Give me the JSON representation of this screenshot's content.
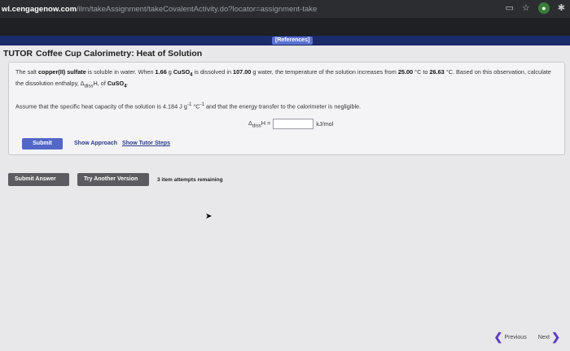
{
  "browser": {
    "url_host": "wl.cengagenow.com",
    "url_path": "/ilrn/takeAssignment/takeCovalentActivity.do?locator=assignment-take"
  },
  "references_label": "[References]",
  "title": {
    "prefix": "TUTOR",
    "text": "Coffee Cup Calorimetry: Heat of Solution"
  },
  "problem": {
    "t1": "The salt ",
    "salt": "copper(II) sulfate",
    "t2": " is soluble in water. When ",
    "mass_salt": "1.66",
    "t3": " g ",
    "formula": "CuSO",
    "formula_sub": "4",
    "t4": " is dissolved in ",
    "mass_water": "107.00",
    "t5": " g water, the temperature of the solution increases from ",
    "t_initial": "25.00",
    "t6": " °C to ",
    "t_final": "26.63",
    "t7": " °C. Based on this observation, calculate the dissolution enthalpy, Δ",
    "dissH_sub": "diss",
    "t8": "H, of ",
    "formula2": "CuSO",
    "formula2_sub": "4",
    "t9": "."
  },
  "assume": {
    "t1": "Assume that the specific heat capacity of the solution is 4.184 J g",
    "sup1": "-1",
    "t2": " °C",
    "sup2": "-1",
    "t3": " and that the energy transfer to the calorimeter is negligible."
  },
  "answer": {
    "delta": "Δ",
    "sub": "diss",
    "label_end": "H =",
    "value": "",
    "unit": "kJ/mol"
  },
  "submit_label": "Submit",
  "links": {
    "show_approach": "Show Approach",
    "show_tutor_steps": "Show Tutor Steps"
  },
  "actions": {
    "submit_answer": "Submit Answer",
    "try_another": "Try Another Version",
    "attempts": "3 item attempts remaining"
  },
  "nav": {
    "previous": "Previous",
    "next": "Next"
  }
}
